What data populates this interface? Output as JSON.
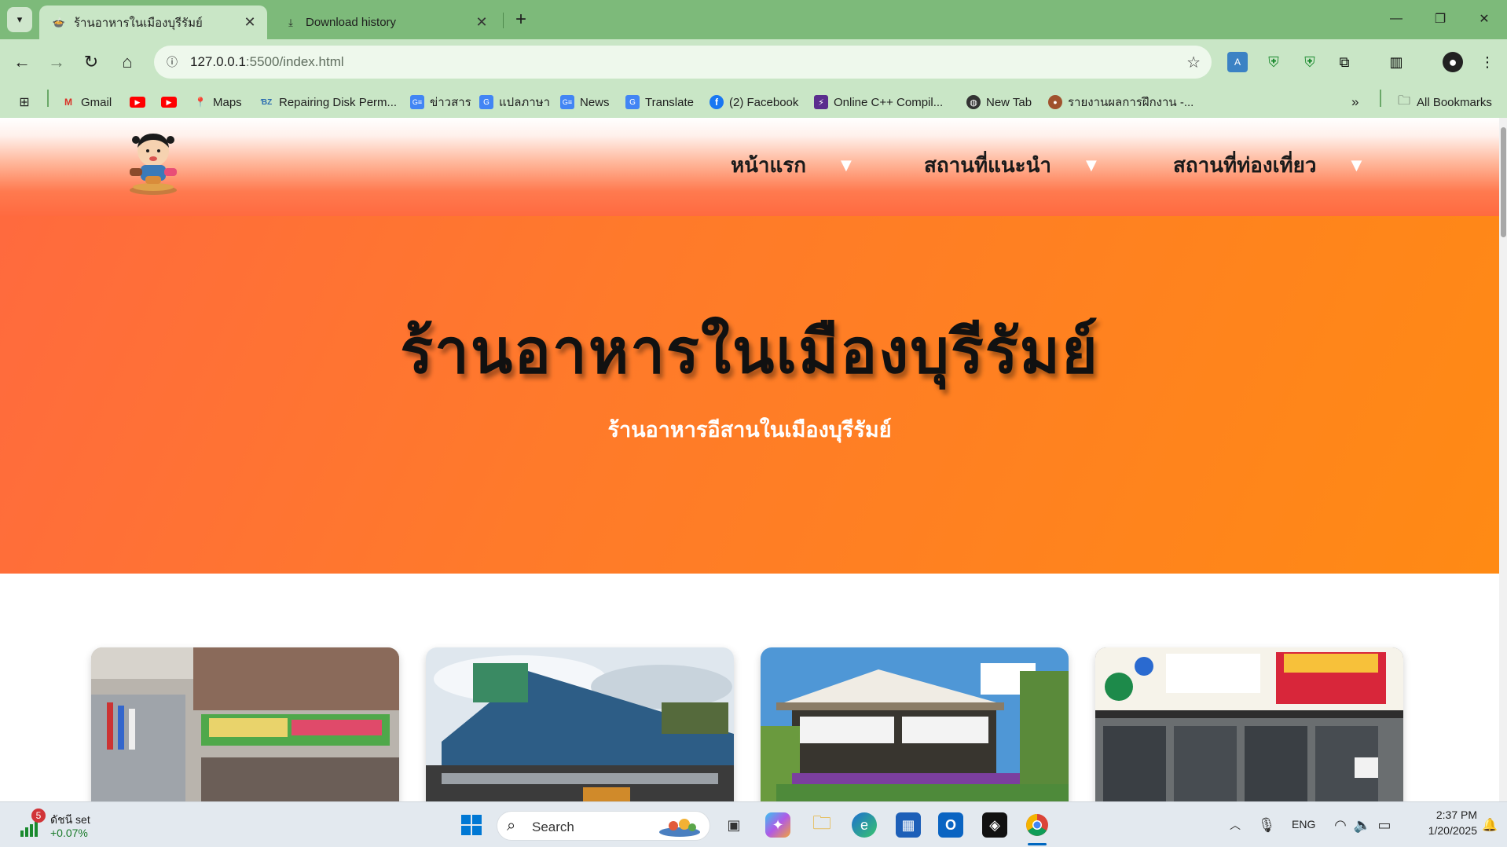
{
  "browser": {
    "tabs": [
      {
        "title": "ร้านอาหารในเมืองบุรีรัมย์",
        "active": true
      },
      {
        "title": "Download history",
        "active": false
      }
    ],
    "url_host": "127.0.0.1",
    "url_path": ":5500/index.html",
    "bookmarks": [
      {
        "label": "Gmail",
        "icon": "gmail-icon"
      },
      {
        "label": "",
        "icon": "youtube-icon"
      },
      {
        "label": "",
        "icon": "youtube-icon"
      },
      {
        "label": "Maps",
        "icon": "maps-icon"
      },
      {
        "label": "Repairing Disk Perm...",
        "icon": "bookmark-site-icon"
      },
      {
        "label": "ข่าวสาร",
        "icon": "google-news-icon"
      },
      {
        "label": "แปลภาษา",
        "icon": "translate-icon"
      },
      {
        "label": "News",
        "icon": "google-news-icon"
      },
      {
        "label": "Translate",
        "icon": "translate-icon"
      },
      {
        "label": "(2) Facebook",
        "icon": "facebook-icon"
      },
      {
        "label": "Online C++ Compil...",
        "icon": "compiler-icon"
      },
      {
        "label": "New Tab",
        "icon": "globe-icon"
      },
      {
        "label": "รายงานผลการฝึกงาน -...",
        "icon": "report-icon"
      }
    ],
    "all_bookmarks_label": "All Bookmarks"
  },
  "site": {
    "menu": [
      "หน้าแรก",
      "สถานที่แนะนำ",
      "สถานที่ท่องเที่ยว"
    ],
    "hero_title": "ร้านอาหารในเมืองบุรีรัมย์",
    "hero_subtitle": "ร้านอาหารอีสานในเมืองบุรีรัมย์"
  },
  "taskbar": {
    "widget_label": "ดัชนี set",
    "widget_value": "+0.07%",
    "widget_badge": "5",
    "search_label": "Search",
    "lang": "ENG",
    "time": "2:37 PM",
    "date": "1/20/2025"
  },
  "colors": {
    "tabstrip": "#7dba7a",
    "toolbar": "#c9e6c6",
    "hero_start": "#ff6a3e",
    "hero_end": "#ff8a14"
  }
}
